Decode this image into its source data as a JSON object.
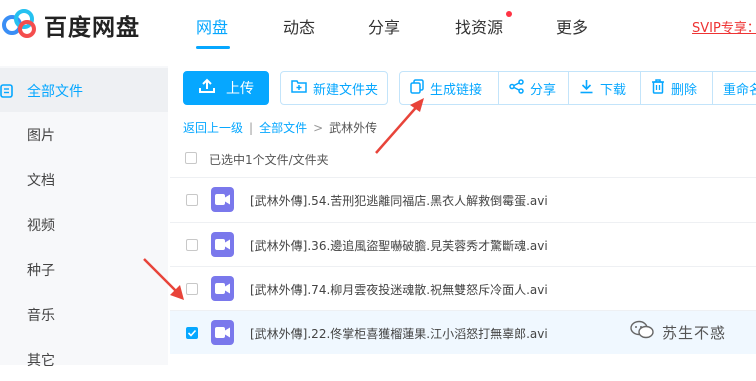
{
  "brand": {
    "name": "百度网盘"
  },
  "nav": [
    {
      "label": "网盘"
    },
    {
      "label": "动态"
    },
    {
      "label": "分享"
    },
    {
      "label": "找资源"
    },
    {
      "label": "更多"
    }
  ],
  "svip": "SVIP专享：",
  "sidebar": {
    "items": [
      {
        "label": "全部文件"
      },
      {
        "label": "图片"
      },
      {
        "label": "文档"
      },
      {
        "label": "视频"
      },
      {
        "label": "种子"
      },
      {
        "label": "音乐"
      },
      {
        "label": "其它"
      }
    ]
  },
  "toolbar": {
    "upload": "上传",
    "new_folder": "新建文件夹",
    "gen_link": "生成链接",
    "share": "分享",
    "download": "下载",
    "delete": "删除",
    "rename": "重命名"
  },
  "breadcrumb": {
    "back": "返回上一级",
    "all": "全部文件",
    "current": "武林外传"
  },
  "selection": "已选中1个文件/文件夹",
  "files": [
    {
      "name": "[武林外傳].54.苦刑犯逃離同福店.黑衣人解救倒霉蛋.avi",
      "checked": false
    },
    {
      "name": "[武林外傳].36.邊追風盜聖嚇破膽.見芙蓉秀才驚斷魂.avi",
      "checked": false
    },
    {
      "name": "[武林外傳].74.柳月雲夜投迷魂散.祝無雙怒斥冷面人.avi",
      "checked": false
    },
    {
      "name": "[武林外傳].22.佟掌柜喜獲榴蓮果.江小滔怒打無辜郎.avi",
      "checked": true
    }
  ],
  "watermark": "苏生不惑",
  "colors": {
    "accent": "#06a7ff",
    "video": "#7a78ec",
    "annotation": "#e8443a"
  }
}
